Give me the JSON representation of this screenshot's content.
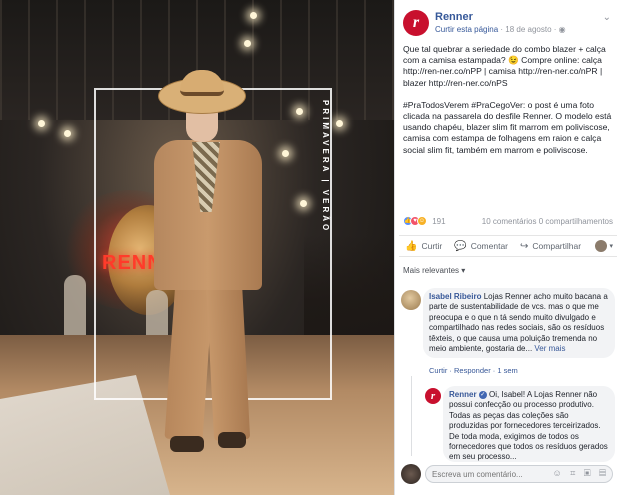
{
  "post": {
    "page_name": "Renner",
    "like_page": "Curtir esta página",
    "date": "18 de agosto",
    "paragraphs": [
      "Que tal quebrar a seriedade do combo blazer + calça com a camisa estampada? 😉 Compre online: calça http://ren-ner.co/nPP | camisa http://ren-ner.co/nPR | blazer http://ren-ner.co/nPS",
      "#PraTodosVerem #PraCegoVer: o post é uma foto clicada na passarela do desfile Renner. O modelo está usando chapéu, blazer slim fit marrom em poliviscose, camisa com estampa de folhagens em raion e calça social slim fit, também em marrom e poliviscose."
    ],
    "frame_text": "PRIMAVERA | VERÃO",
    "photo_sign": "RENNER"
  },
  "reactions": {
    "count": "191",
    "comments": "10 comentários",
    "shares": "0 compartilhamentos"
  },
  "actions": {
    "like": "Curtir",
    "comment": "Comentar",
    "share": "Compartilhar"
  },
  "comments": {
    "filter": "Mais relevantes",
    "c1": {
      "name": "Isabel Ribeiro",
      "text": "Lojas Renner acho muito bacana a parte de sustentabilidade de vcs. mas o que me preocupa e o que n tá sendo muito divulgado e compartilhado nas redes sociais, são os resíduos têxteis, o que causa uma poluição tremenda no meio ambiente, gostaria de...",
      "see_more": "Ver mais",
      "actions": "Curtir · Responder · 1 sem"
    },
    "c2": {
      "name": "Renner",
      "text": "Oi, Isabel! A Lojas Renner não possui confecção ou processo produtivo. Todas as peças das coleções são produzidas por fornecedores terceirizados. De toda moda, exigimos de todos os fornecedores que todos os resíduos gerados em seu processo..."
    },
    "write_placeholder": "Escreva um comentário..."
  },
  "icons": {
    "logo": "renner-logo",
    "more": "chevron-down-icon",
    "like": "thumbs-up-icon",
    "comment": "comment-icon",
    "share": "share-icon"
  },
  "colors": {
    "brand_red": "#c8102e",
    "link_blue": "#365899"
  }
}
